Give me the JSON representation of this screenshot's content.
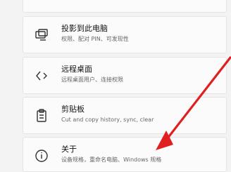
{
  "settings_items": [
    {
      "title": "投影到此电脑",
      "subtitle": "权限、配对 PIN、可发现性",
      "icon": "project-to-pc-icon"
    },
    {
      "title": "远程桌面",
      "subtitle": "远程桌面用户、连接权限",
      "icon": "remote-desktop-icon"
    },
    {
      "title": "剪贴板",
      "subtitle": "Cut and copy history, sync, clear",
      "icon": "clipboard-icon"
    },
    {
      "title": "关于",
      "subtitle": "设备规格，重命名电脑、Windows 规格",
      "icon": "info-icon"
    }
  ],
  "annotation": {
    "arrow_color": "#e02020"
  }
}
